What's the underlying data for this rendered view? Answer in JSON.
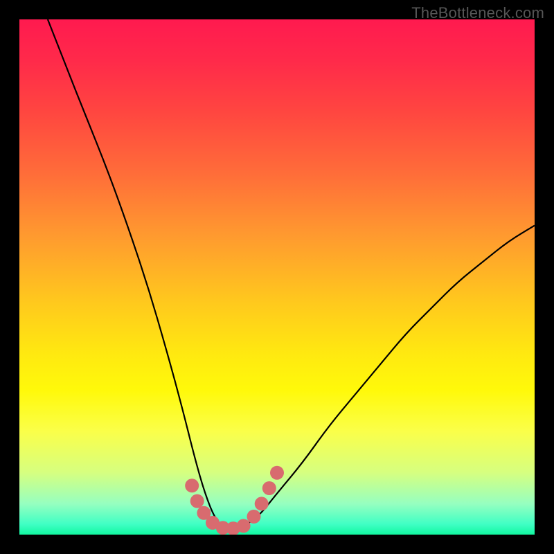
{
  "watermark": "TheBottleneck.com",
  "chart_data": {
    "type": "line",
    "title": "",
    "xlabel": "",
    "ylabel": "",
    "xlim": [
      0,
      1
    ],
    "ylim": [
      0,
      1
    ],
    "series": [
      {
        "name": "bottleneck-curve",
        "x": [
          0.055,
          0.09,
          0.13,
          0.17,
          0.21,
          0.25,
          0.285,
          0.315,
          0.34,
          0.36,
          0.38,
          0.4,
          0.42,
          0.46,
          0.5,
          0.55,
          0.6,
          0.65,
          0.7,
          0.75,
          0.8,
          0.85,
          0.9,
          0.95,
          1.0
        ],
        "y": [
          1.0,
          0.91,
          0.81,
          0.71,
          0.6,
          0.48,
          0.36,
          0.25,
          0.15,
          0.08,
          0.03,
          0.01,
          0.01,
          0.03,
          0.08,
          0.14,
          0.21,
          0.27,
          0.33,
          0.39,
          0.44,
          0.49,
          0.53,
          0.57,
          0.6
        ]
      }
    ],
    "markers": {
      "name": "highlight-points",
      "color": "#d86b6f",
      "points": [
        {
          "x": 0.335,
          "y": 0.095
        },
        {
          "x": 0.345,
          "y": 0.065
        },
        {
          "x": 0.358,
          "y": 0.042
        },
        {
          "x": 0.375,
          "y": 0.023
        },
        {
          "x": 0.395,
          "y": 0.013
        },
        {
          "x": 0.415,
          "y": 0.012
        },
        {
          "x": 0.435,
          "y": 0.017
        },
        {
          "x": 0.455,
          "y": 0.035
        },
        {
          "x": 0.47,
          "y": 0.06
        },
        {
          "x": 0.485,
          "y": 0.09
        },
        {
          "x": 0.5,
          "y": 0.12
        }
      ]
    }
  }
}
